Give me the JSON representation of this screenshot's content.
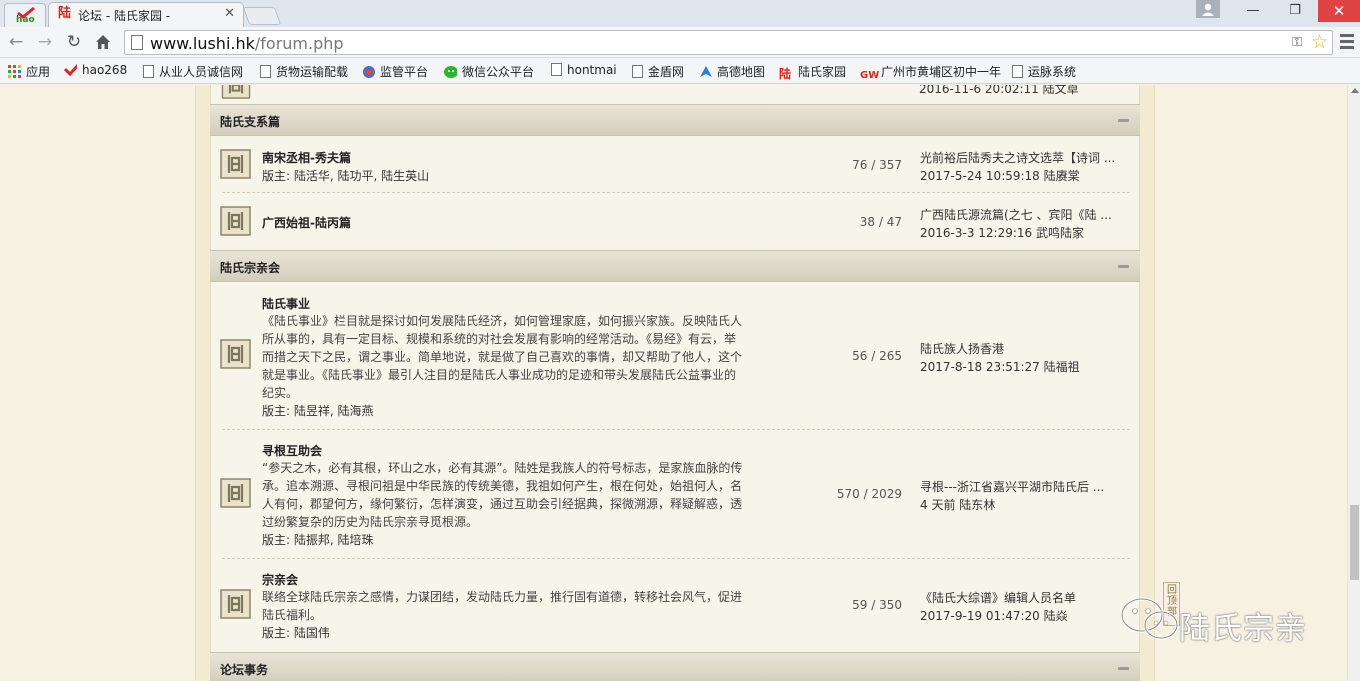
{
  "browser": {
    "tab_title": "论坛 - 陆氏家园 -",
    "tab_close": "✕",
    "url_host": "www.lushi.hk",
    "url_path": "/forum.php",
    "window_min": "—",
    "window_max": "❐",
    "window_close": "✕",
    "hao_logo": "hao"
  },
  "bookmarks": [
    {
      "label": "应用",
      "icon": "apps-icon"
    },
    {
      "label": "hao268",
      "icon": "hao-icon"
    },
    {
      "label": "从业人员诚信网",
      "icon": "file-icon"
    },
    {
      "label": "货物运输配载",
      "icon": "file-icon"
    },
    {
      "label": "监管平台",
      "icon": "globe-icon"
    },
    {
      "label": "微信公众平台",
      "icon": "wechat-icon"
    },
    {
      "label": "hontmai",
      "icon": "file-icon"
    },
    {
      "label": "金盾网",
      "icon": "file-icon"
    },
    {
      "label": "高德地图",
      "icon": "amap-icon"
    },
    {
      "label": "陆氏家园",
      "icon": "lu-icon"
    },
    {
      "label": "广州市黄埔区初中一年",
      "icon": "gw-icon"
    },
    {
      "label": "运脉系统",
      "icon": "file-icon"
    }
  ],
  "cut_row": {
    "last_meta": "2016-11-6 20:02:11 陆文卓"
  },
  "categories": [
    {
      "title": "陆氏支系篇",
      "forums": [
        {
          "name": "南宋丞相-秀夫篇",
          "mods": "版主: 陆活华, 陆功平, 陆生英山",
          "stats": "76 / 357",
          "last_title": "光前裕后陆秀夫之诗文选萃【诗词 ...",
          "last_meta": "2017-5-24 10:59:18 陆赓棠"
        },
        {
          "name": "广西始祖-陆丙篇",
          "mods": "",
          "stats": "38 / 47",
          "last_title": "广西陆氏源流篇(之七 、宾阳《陆 ...",
          "last_meta": "2016-3-3 12:29:16 武鸣陆家"
        }
      ]
    },
    {
      "title": "陆氏宗亲会",
      "forums": [
        {
          "name": "陆氏事业",
          "desc": "《陆氏事业》栏目就是探讨如何发展陆氏经济，如何管理家庭，如何振兴家族。反映陆氏人所从事的，具有一定目标、规模和系统的对社会发展有影响的经常活动。《易经》有云，举而措之天下之民，谓之事业。简单地说，就是做了自己喜欢的事情，却又帮助了他人，这个就是事业。《陆氏事业》最引人注目的是陆氏人事业成功的足迹和带头发展陆氏公益事业的纪实。",
          "mods": "版主: 陆昱祥, 陆海燕",
          "stats": "56 / 265",
          "last_title": "陆氏族人扬香港",
          "last_meta": "2017-8-18 23:51:27 陆福祖"
        },
        {
          "name": "寻根互助会",
          "desc": "“参天之木，必有其根，环山之水，必有其源”。陆姓是我族人的符号标志，是家族血脉的传承。追本溯源、寻根问祖是中华民族的传统美德，我祖如何产生，根在何处，始祖何人，名人有何，郡望何方，缘何繁衍，怎样演变，通过互助会引经据典，探微溯源，释疑解惑，透过纷繁复杂的历史为陆氏宗亲寻觅根源。",
          "mods": "版主: 陆振邦, 陆培珠",
          "stats": "570 / 2029",
          "last_title": "寻根---浙江省嘉兴平湖市陆氏后 ...",
          "last_meta": "4 天前 陆东林"
        },
        {
          "name": "宗亲会",
          "desc": "联络全球陆氏宗亲之感情，力谋团结，发动陆氏力量，推行固有道德，转移社会风气，促进陆氏福利。",
          "mods": "版主: 陆国伟",
          "stats": "59 / 350",
          "last_title": "《陆氏大综谱》编辑人员名单",
          "last_meta": "2017-9-19 01:47:20 陆焱"
        }
      ]
    },
    {
      "title": "论坛事务",
      "forums": []
    }
  ],
  "back_to_top": "回顶部",
  "watermark": "陆氏宗亲",
  "colors": {
    "category_bg": "#d9d3c2",
    "page_bg": "#f6f1e1",
    "forum_bg": "#f7f4ea",
    "close_red": "#e04343"
  }
}
